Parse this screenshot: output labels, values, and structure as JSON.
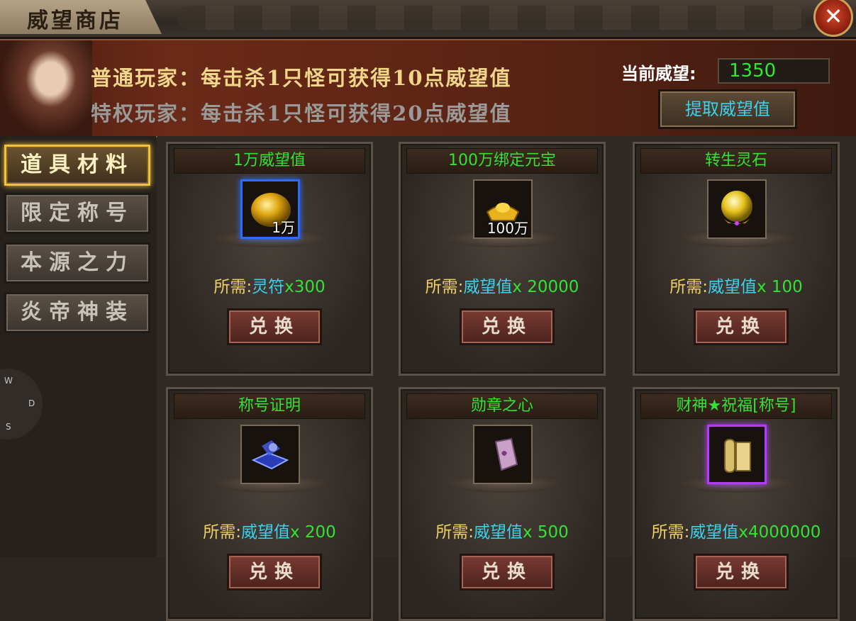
{
  "window": {
    "title": "威望商店",
    "close_label": "✕"
  },
  "banner": {
    "normal_player": "普通玩家：每击杀1只怪可获得10点威望值",
    "vip_player": "特权玩家：每击杀1只怪可获得20点威望值",
    "current_prestige_label": "当前威望:",
    "current_prestige_value": "1350",
    "withdraw_button": "提取威望值"
  },
  "sidebar": {
    "items": [
      {
        "label": "道具材料",
        "active": true
      },
      {
        "label": "限定称号",
        "active": false
      },
      {
        "label": "本源之力",
        "active": false
      },
      {
        "label": "炎帝神装",
        "active": false
      }
    ]
  },
  "compass": {
    "w": "W",
    "d": "D",
    "s": "S"
  },
  "items": [
    {
      "name": "1万威望值",
      "qty": "1万",
      "req_label": "所需:",
      "currency": "灵符",
      "amount": "x300",
      "button": "兑换",
      "icon": "gold-orb-icon",
      "frame_color": "#2a6cff"
    },
    {
      "name": "100万绑定元宝",
      "qty": "100万",
      "req_label": "所需:",
      "currency": "威望值",
      "amount": "x 20000",
      "button": "兑换",
      "icon": "gold-ingot-icon",
      "frame_color": "#7a6a58"
    },
    {
      "name": "转生灵石",
      "qty": "",
      "req_label": "所需:",
      "currency": "威望值",
      "amount": "x 100",
      "button": "兑换",
      "icon": "gold-sphere-icon",
      "frame_color": "#7a6a58"
    },
    {
      "name": "称号证明",
      "qty": "",
      "req_label": "所需:",
      "currency": "威望值",
      "amount": "x 200",
      "button": "兑换",
      "icon": "book-icon",
      "frame_color": "#7a6a58"
    },
    {
      "name": "勋章之心",
      "qty": "",
      "req_label": "所需:",
      "currency": "威望值",
      "amount": "x 500",
      "button": "兑换",
      "icon": "medal-heart-icon",
      "frame_color": "#7a6a58"
    },
    {
      "name": "财神★祝福[称号]",
      "qty": "",
      "req_label": "所需:",
      "currency": "威望值",
      "amount": "x4000000",
      "button": "兑换",
      "icon": "scroll-icon",
      "frame_color": "#b23cff"
    }
  ]
}
